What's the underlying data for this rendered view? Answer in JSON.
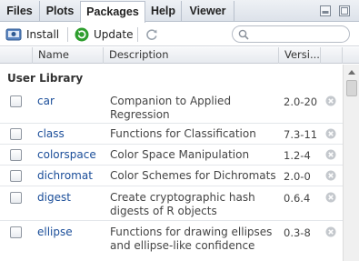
{
  "tabs": [
    {
      "label": "Files"
    },
    {
      "label": "Plots"
    },
    {
      "label": "Packages"
    },
    {
      "label": "Help"
    },
    {
      "label": "Viewer"
    }
  ],
  "toolbar": {
    "install_label": "Install",
    "update_label": "Update",
    "search_placeholder": ""
  },
  "columns": {
    "name": "Name",
    "description": "Description",
    "version": "Versi..."
  },
  "group_label": "User Library",
  "packages": [
    {
      "name": "car",
      "desc1": "Companion to Applied",
      "desc2": "Regression",
      "version": "2.0-20"
    },
    {
      "name": "class",
      "desc1": "Functions for Classification",
      "desc2": "",
      "version": "7.3-11"
    },
    {
      "name": "colorspace",
      "desc1": "Color Space Manipulation",
      "desc2": "",
      "version": "1.2-4"
    },
    {
      "name": "dichromat",
      "desc1": "Color Schemes for Dichromats",
      "desc2": "",
      "version": "2.0-0"
    },
    {
      "name": "digest",
      "desc1": "Create cryptographic hash",
      "desc2": "digests of R objects",
      "version": "0.6.4"
    },
    {
      "name": "ellipse",
      "desc1": "Functions for drawing ellipses",
      "desc2": "and ellipse-like confidence",
      "version": "0.3-8"
    }
  ],
  "colors": {
    "link": "#1a4d99",
    "update_green": "#2e9e2e",
    "install_blue": "#4a78b5"
  }
}
